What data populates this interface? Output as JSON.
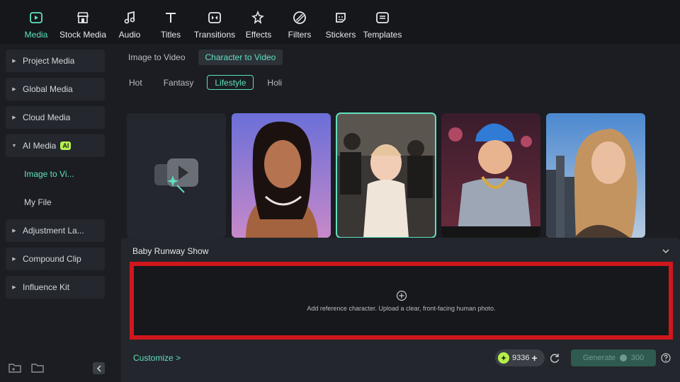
{
  "toolbar": {
    "items": [
      {
        "label": "Media",
        "icon": "media-icon"
      },
      {
        "label": "Stock Media",
        "icon": "stock-media-icon"
      },
      {
        "label": "Audio",
        "icon": "music-note-icon"
      },
      {
        "label": "Titles",
        "icon": "text-t-icon"
      },
      {
        "label": "Transitions",
        "icon": "transitions-icon"
      },
      {
        "label": "Effects",
        "icon": "effects-sparkle-icon"
      },
      {
        "label": "Filters",
        "icon": "filters-icon"
      },
      {
        "label": "Stickers",
        "icon": "sticker-icon"
      },
      {
        "label": "Templates",
        "icon": "templates-icon"
      }
    ]
  },
  "sidebar": {
    "items": [
      {
        "label": "Project Media"
      },
      {
        "label": "Global Media"
      },
      {
        "label": "Cloud Media"
      },
      {
        "label": "AI Media",
        "badge": "AI"
      },
      {
        "label": "Image to Vi..."
      },
      {
        "label": "My File"
      },
      {
        "label": "Adjustment La..."
      },
      {
        "label": "Compound Clip"
      },
      {
        "label": "Influence Kit"
      }
    ]
  },
  "main": {
    "mode_tabs": [
      "Image to Video",
      "Character to Video"
    ],
    "category_tabs": [
      "Hot",
      "Fantasy",
      "Lifestyle",
      "Holi"
    ],
    "panel": {
      "title": "Baby Runway Show",
      "dropzone_hint": "Add reference character. Upload a clear, front-facing human photo.",
      "customize": "Customize >",
      "credits": "9336",
      "generate_label": "Generate",
      "generate_cost": "300"
    }
  },
  "colors": {
    "accent": "#5fe0c0",
    "ai_badge": "#b6f04a",
    "highlight_border": "#d0171c"
  }
}
